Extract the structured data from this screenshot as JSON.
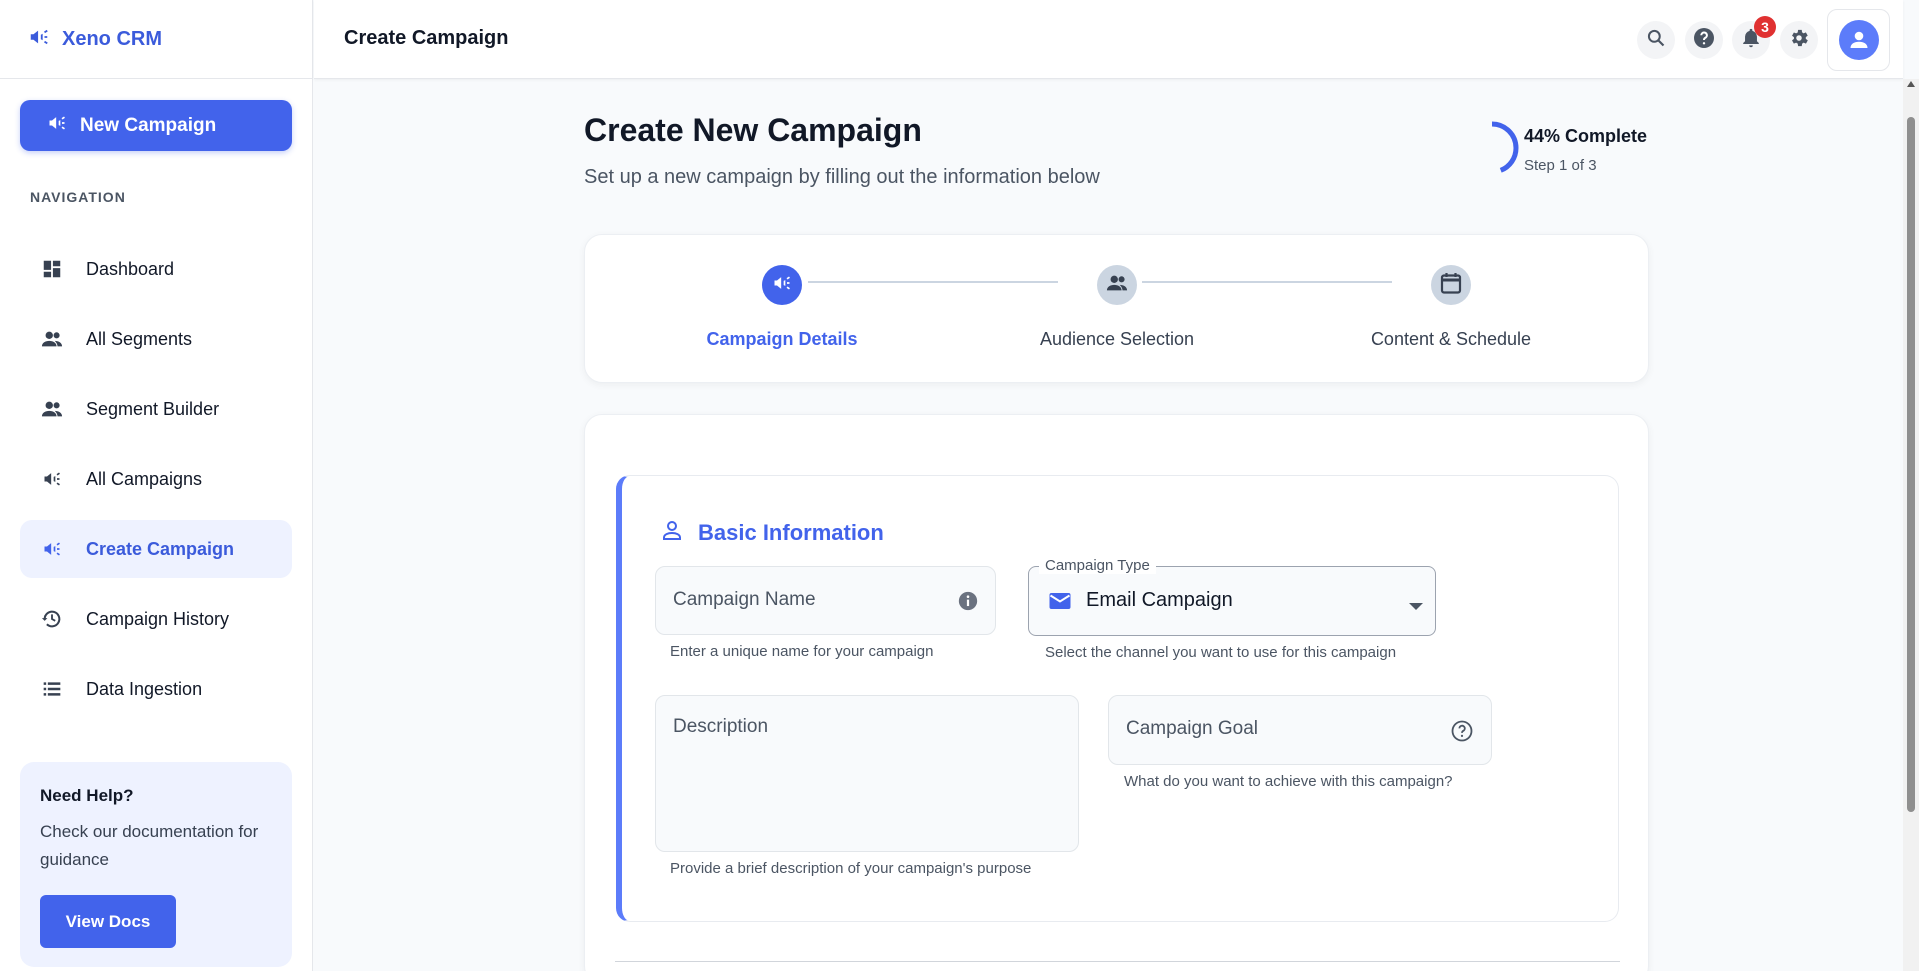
{
  "app": {
    "name": "Xeno CRM"
  },
  "sidebar": {
    "new_campaign_label": "New Campaign",
    "nav_heading": "NAVIGATION",
    "items": [
      {
        "label": "Dashboard",
        "icon": "dashboard-icon",
        "active": false
      },
      {
        "label": "All Segments",
        "icon": "users-icon",
        "active": false
      },
      {
        "label": "Segment Builder",
        "icon": "users-icon",
        "active": false
      },
      {
        "label": "All Campaigns",
        "icon": "megaphone-icon",
        "active": false
      },
      {
        "label": "Create Campaign",
        "icon": "megaphone-icon",
        "active": true
      },
      {
        "label": "Campaign History",
        "icon": "history-icon",
        "active": false
      },
      {
        "label": "Data Ingestion",
        "icon": "list-icon",
        "active": false
      }
    ],
    "help": {
      "title": "Need Help?",
      "text": "Check our documentation for guidance",
      "button_label": "View Docs"
    }
  },
  "header": {
    "title": "Create Campaign",
    "notification_count": "3",
    "icons": [
      "search-icon",
      "help-icon",
      "bell-icon",
      "gear-icon",
      "avatar-icon"
    ]
  },
  "page": {
    "title": "Create New Campaign",
    "subtitle": "Set up a new campaign by filling out the information below",
    "progress": {
      "percent": 44,
      "label": "44% Complete",
      "step_text": "Step 1 of 3"
    }
  },
  "stepper": {
    "steps": [
      {
        "label": "Campaign Details",
        "icon": "megaphone-icon",
        "active": true
      },
      {
        "label": "Audience Selection",
        "icon": "users-icon",
        "active": false
      },
      {
        "label": "Content & Schedule",
        "icon": "calendar-icon",
        "active": false
      }
    ]
  },
  "form": {
    "section_title": "Basic Information",
    "campaign_name": {
      "label": "Campaign Name",
      "helper": "Enter a unique name for your campaign"
    },
    "campaign_type": {
      "label": "Campaign Type",
      "value": "Email Campaign",
      "helper": "Select the channel you want to use for this campaign"
    },
    "description": {
      "label": "Description",
      "helper": "Provide a brief description of your campaign's purpose"
    },
    "campaign_goal": {
      "label": "Campaign Goal",
      "helper": "What do you want to achieve with this campaign?"
    }
  },
  "colors": {
    "primary": "#4263eb",
    "active_bg": "#eef2ff",
    "badge": "#e03131",
    "section_accent": "#5c7cfa"
  }
}
